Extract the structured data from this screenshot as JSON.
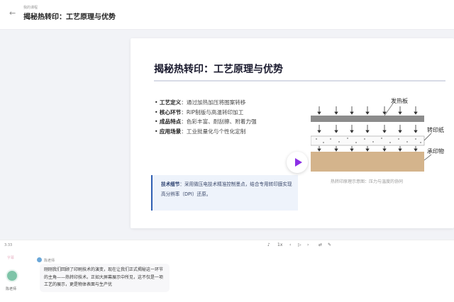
{
  "header": {
    "breadcrumb": "我的课程",
    "title": "揭秘热转印：工艺原理与优势"
  },
  "slide": {
    "title": "揭秘热转印：工艺原理与优势",
    "bullets": [
      {
        "term": "工艺定义",
        "text": "：通过加热加压将图案转移"
      },
      {
        "term": "核心环节",
        "text": "：RIP制版与高温转印加工"
      },
      {
        "term": "成品特点",
        "text": "：色彩丰富、耐刮擦、附着力强"
      },
      {
        "term": "应用场景",
        "text": "：工业批量化与个性化定制"
      }
    ],
    "note": {
      "term": "技术细节",
      "text": "：采用微压电技术精准控制墨点，结合专用转印膜实现高分辨率（DPI）还原。"
    },
    "diagram": {
      "label_top": "发热板",
      "label_mid": "转印纸",
      "label_bottom": "承印物"
    },
    "caption": "热转印原理示意图：压力与温度的协同"
  },
  "player": {
    "time": "3:33",
    "speed": "1x"
  },
  "chat": {
    "hint": "字幕",
    "teacher_name": "陈老师",
    "speaker": "陈老师",
    "message": "刚刚我们回顾了印刷技术的演变，现在让我们正式揭秘这一环节的主角——热转印技术。正如大屏幕展示中所见，这不仅是一项工艺的展示，更是物体表面与生产优"
  },
  "colors": {
    "accent": "#8b2fe6",
    "note_bar": "#2f5fb3"
  }
}
